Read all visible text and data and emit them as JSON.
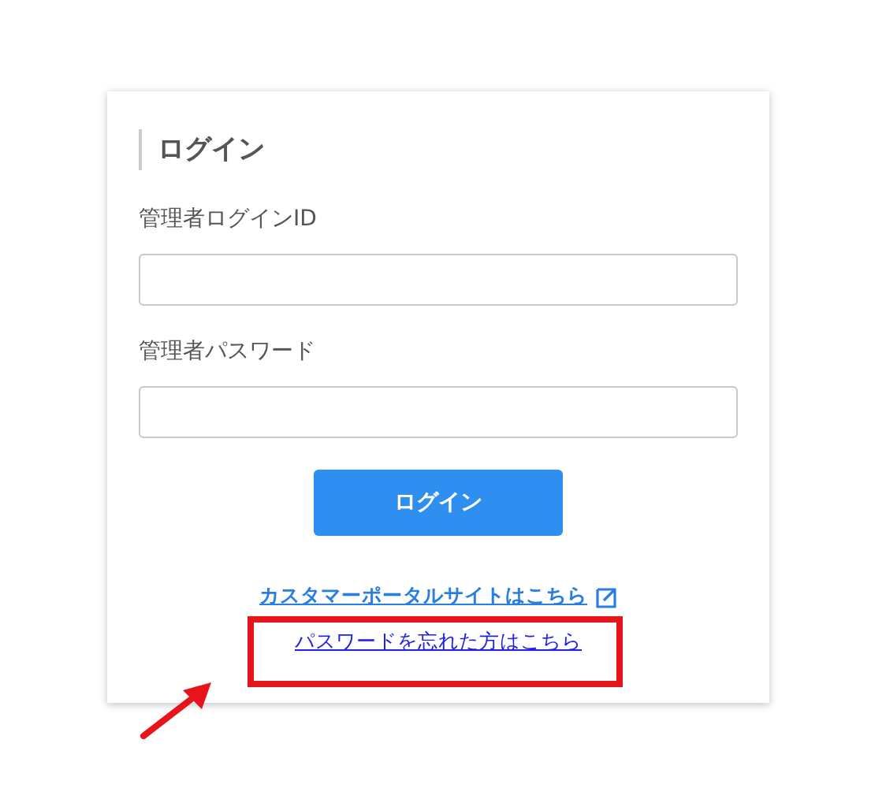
{
  "login_card": {
    "title": "ログイン",
    "fields": [
      {
        "label": "管理者ログインID"
      },
      {
        "label": "管理者パスワード"
      }
    ],
    "button": "ログイン",
    "links": [
      {
        "text": "カスタマーポータルサイトはこちら",
        "external": true,
        "highlighted": false
      },
      {
        "text": "パスワードを忘れた方はこちら",
        "external": false,
        "highlighted": true
      }
    ]
  }
}
